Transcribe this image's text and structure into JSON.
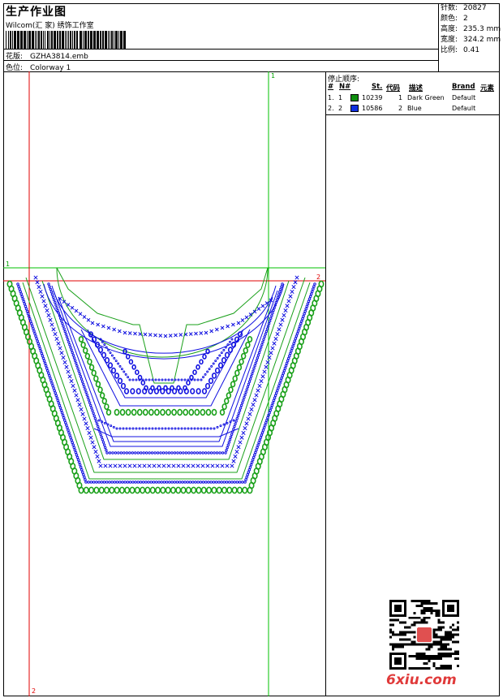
{
  "header": {
    "title": "生产作业图",
    "company": "Wilcom(汇 家) 绣饰工作室",
    "design_label": "花版:",
    "design_value": "GZHA3814.emb",
    "colorway_label": "色位:",
    "colorway_value": "Colorway 1"
  },
  "stats": [
    {
      "label": "针数:",
      "value": "20827"
    },
    {
      "label": "颜色:",
      "value": "2"
    },
    {
      "label": "高度:",
      "value": "235.3 mm"
    },
    {
      "label": "宽度:",
      "value": "324.2 mm"
    },
    {
      "label": "比例:",
      "value": "0.41"
    }
  ],
  "design": {
    "guide_labels": {
      "green_v": "1",
      "green_h": "1",
      "red_h": "2",
      "red_v": "2"
    },
    "colors": {
      "green": "#1aa01a",
      "blue": "#1010e0",
      "guide_green": "#00c000",
      "guide_red": "#e00000"
    }
  },
  "stop_sequence": {
    "title": "停止顺序:",
    "headers": {
      "num": "#",
      "n": "N#",
      "st": "St.",
      "code": "代码",
      "desc": "描述",
      "brand": "Brand",
      "elements": "元素"
    },
    "rows": [
      {
        "num": "1.",
        "n": "1",
        "swatch": "#0f8f0f",
        "st": "10239",
        "code": "1",
        "desc": "Dark Green",
        "brand": "Default"
      },
      {
        "num": "2.",
        "n": "2",
        "swatch": "#1030e0",
        "st": "10586",
        "code": "2",
        "desc": "Blue",
        "brand": "Default"
      }
    ]
  },
  "watermark": "6xiu.com"
}
